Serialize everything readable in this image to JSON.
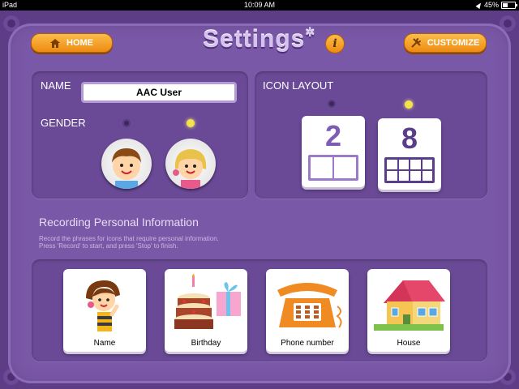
{
  "status_bar": {
    "device": "iPad",
    "time": "10:09 AM",
    "battery": "45%"
  },
  "header": {
    "home_label": "HOME",
    "title": "Settings",
    "title_mark": "✲",
    "info_label": "i",
    "customize_label": "CUSTOMIZE"
  },
  "profile": {
    "name_label": "NAME",
    "name_value": "AAC User",
    "gender_label": "GENDER",
    "gender_options": [
      "boy",
      "girl"
    ],
    "gender_selected": "girl"
  },
  "icon_layout": {
    "label": "ICON LAYOUT",
    "options": [
      {
        "value": "2",
        "selected": false
      },
      {
        "value": "8",
        "selected": true
      }
    ]
  },
  "recording": {
    "title": "Recording Personal Information",
    "description_line1": "Record the phrases for icons that require personal information.",
    "description_line2": "Press 'Record' to start, and press 'Stop' to finish.",
    "items": [
      {
        "label": "Name",
        "icon": "girl-pointing-icon"
      },
      {
        "label": "Birthday",
        "icon": "birthday-cake-icon"
      },
      {
        "label": "Phone number",
        "icon": "telephone-icon"
      },
      {
        "label": "House",
        "icon": "house-icon"
      }
    ]
  },
  "colors": {
    "background": "#5c3d86",
    "panel": "#7a58a8",
    "accent_orange": "#ee8b12",
    "selected_dot": "#f3e24a",
    "layout_purple": "#6b4c9a"
  }
}
